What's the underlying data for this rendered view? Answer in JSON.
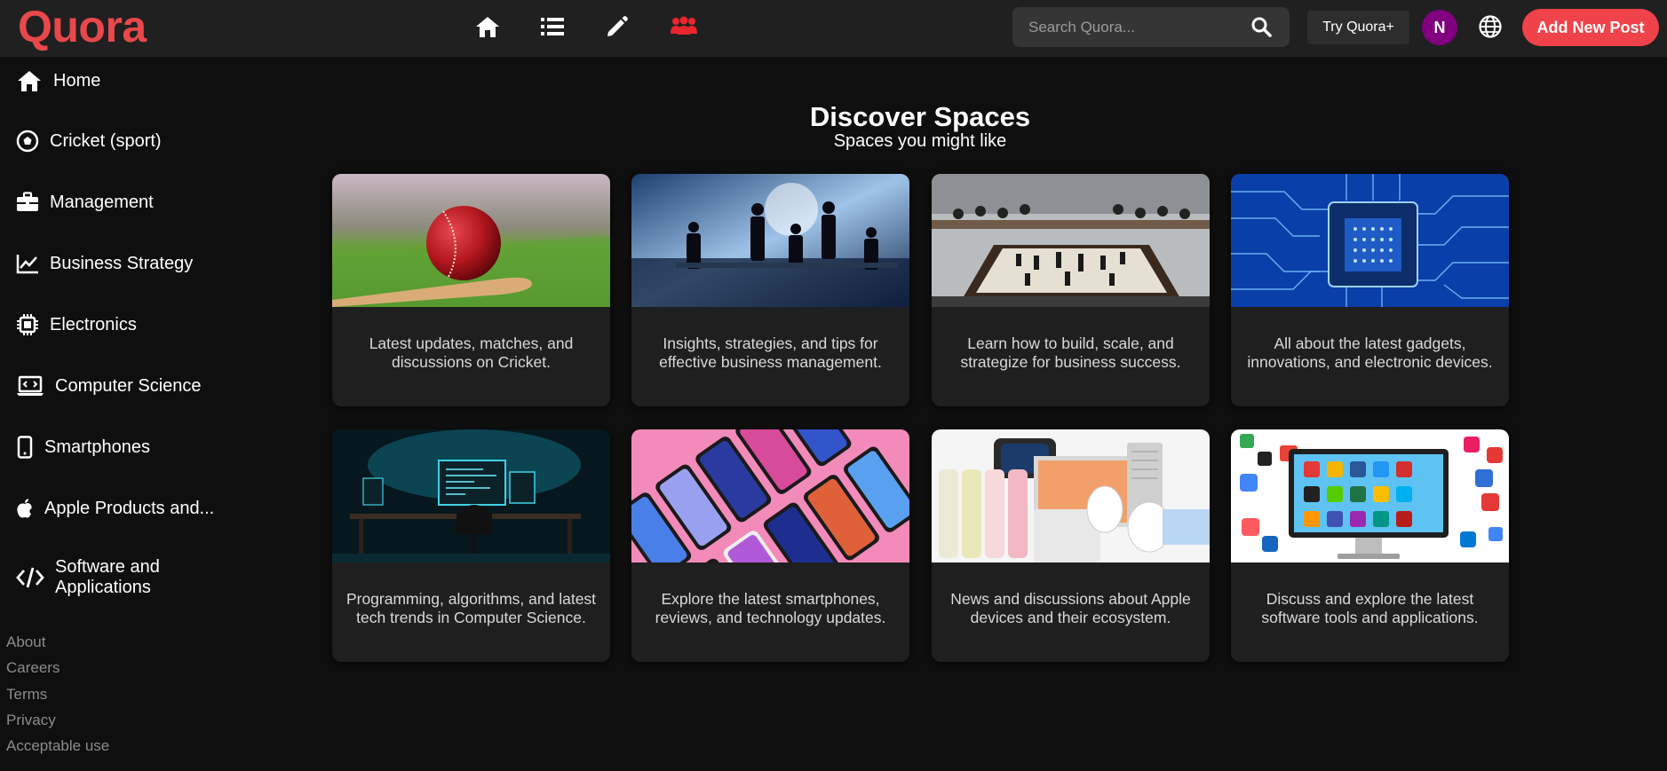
{
  "header": {
    "logo": "Quora",
    "search_placeholder": "Search Quora...",
    "try_plus_label": "Try Quora+",
    "avatar_initial": "N",
    "add_post_label": "Add New Post",
    "nav_icons": [
      "home-icon",
      "list-icon",
      "pencil-icon",
      "users-icon"
    ],
    "accent_color": "#e8484b",
    "avatar_color": "#800080",
    "add_post_color": "#f0424a"
  },
  "sidebar": {
    "items": [
      {
        "label": "Home",
        "icon": "home-icon"
      },
      {
        "label": "Cricket (sport)",
        "icon": "soccer-ball-icon"
      },
      {
        "label": "Management",
        "icon": "briefcase-icon"
      },
      {
        "label": "Business Strategy",
        "icon": "line-chart-icon"
      },
      {
        "label": "Electronics",
        "icon": "chip-icon"
      },
      {
        "label": "Computer Science",
        "icon": "laptop-code-icon"
      },
      {
        "label": "Smartphones",
        "icon": "smartphone-icon"
      },
      {
        "label": "Apple Products and...",
        "icon": "apple-icon"
      },
      {
        "label": "Software and Applications",
        "icon": "code-icon"
      }
    ],
    "footer_links": [
      "About",
      "Careers",
      "Terms",
      "Privacy",
      "Acceptable use"
    ]
  },
  "main": {
    "title": "Discover Spaces",
    "subtitle": "Spaces you might like",
    "spaces": [
      {
        "description": "Latest updates, matches, and discussions on Cricket.",
        "image": "cricket-ball-image"
      },
      {
        "description": "Insights, strategies, and tips for effective business management.",
        "image": "business-meeting-image"
      },
      {
        "description": "Learn how to build, scale, and strategize for business success.",
        "image": "chess-strategy-image"
      },
      {
        "description": "All about the latest gadgets, innovations, and electronic devices.",
        "image": "circuit-chip-image"
      },
      {
        "description": "Programming, algorithms, and latest tech trends in Computer Science.",
        "image": "computer-desk-image"
      },
      {
        "description": "Explore the latest smartphones, reviews, and technology updates.",
        "image": "smartphones-image"
      },
      {
        "description": "News and discussions about Apple devices and their ecosystem.",
        "image": "apple-products-image"
      },
      {
        "description": "Discuss and explore the latest software tools and applications.",
        "image": "app-icons-monitor-image"
      }
    ]
  }
}
